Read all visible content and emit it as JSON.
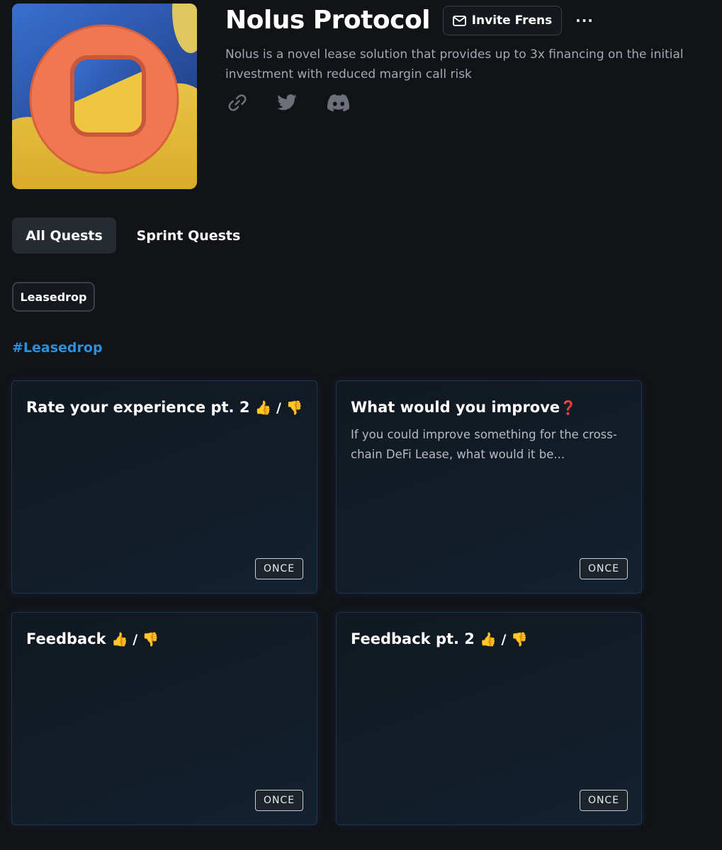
{
  "project": {
    "name": "Nolus Protocol",
    "description": "Nolus is a novel lease solution that provides up to 3x financing on the initial investment with reduced margin call risk",
    "invite_label": "Invite Frens",
    "more_label": "···",
    "brand_colors": {
      "logo_ring": "#f07850",
      "logo_blue": "#2f5fb8",
      "logo_yellow": "#f1cd45"
    },
    "social_icons": [
      "link-icon",
      "twitter-icon",
      "discord-icon"
    ]
  },
  "tabs": [
    {
      "label": "All Quests",
      "active": true
    },
    {
      "label": "Sprint Quests",
      "active": false
    }
  ],
  "filters": [
    {
      "label": "Leasedrop"
    }
  ],
  "section": {
    "heading": "#Leasedrop",
    "heading_color": "#2f8fd8"
  },
  "quests": [
    {
      "title": "Rate your experience pt. 2",
      "emoji": "👍 / 👎",
      "description": "",
      "frequency": "ONCE"
    },
    {
      "title": "What would you improve",
      "emoji": "❓",
      "description": "If you could improve something for the cross-chain DeFi Lease, what would it be...",
      "frequency": "ONCE"
    },
    {
      "title": "Feedback",
      "emoji": "👍 / 👎",
      "description": "",
      "frequency": "ONCE"
    },
    {
      "title": "Feedback pt. 2",
      "emoji": "👍 / 👎",
      "description": "",
      "frequency": "ONCE"
    }
  ]
}
